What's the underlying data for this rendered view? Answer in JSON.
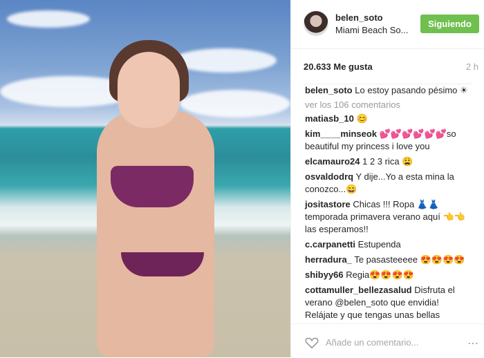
{
  "post": {
    "username": "belen_soto",
    "location": "Miami Beach So...",
    "follow_label": "Siguiendo",
    "likes": "20.633 Me gusta",
    "time": "2 h",
    "caption_user": "belen_soto",
    "caption_text": "Lo estoy pasando pésimo ☀",
    "view_comments": "ver los 106 comentarios"
  },
  "comments": [
    {
      "user": "matiasb_10",
      "text": "😊"
    },
    {
      "user": "kim____minseok",
      "text": "💕💕💕💕💕💕so beautiful my princess i love you"
    },
    {
      "user": "elcamauro24",
      "text": "1 2 3 rica 😩"
    },
    {
      "user": "osvaldodrq",
      "text": "Y dije...Yo a esta mina la conozco...😄"
    },
    {
      "user": "jositastore",
      "text": "Chicas !!! Ropa 👗👗 temporada primavera verano aquí 👈👈 las esperamos!!"
    },
    {
      "user": "c.carpanetti",
      "text": "Estupenda"
    },
    {
      "user": "herradura_",
      "text": "Te pasasteeeee 😍😍😍😍"
    },
    {
      "user": "shibyy66",
      "text": "Regia😍😍😍😍"
    },
    {
      "user": "cottamuller_bellezasalud",
      "text": "Disfruta el verano @belen_soto que envidia! Relájate y que tengas unas bellas vacaciones! te invito a ver mi cuenta con"
    }
  ],
  "footer": {
    "add_comment_placeholder": "Añade un comentario...",
    "more_label": "⋯"
  },
  "colors": {
    "follow_bg": "#70c050",
    "muted": "#a5a7aa"
  },
  "icons": {
    "like": "heart-icon",
    "more": "more-options-icon"
  }
}
